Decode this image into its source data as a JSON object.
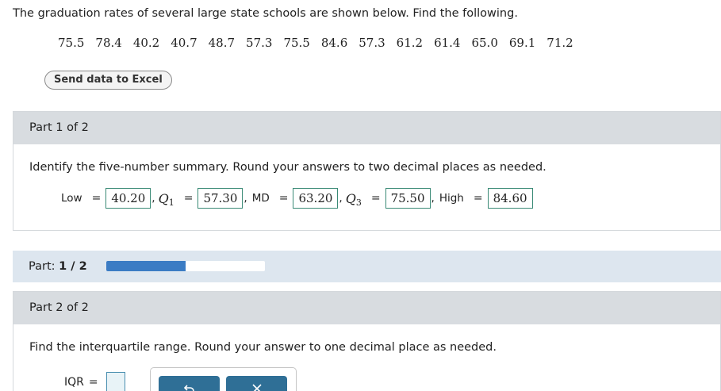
{
  "question": {
    "intro": "The graduation rates of several large state schools are shown below. Find the following.",
    "data_values": [
      "75.5",
      "78.4",
      "40.2",
      "40.7",
      "48.7",
      "57.3",
      "75.5",
      "84.6",
      "57.3",
      "61.2",
      "61.4",
      "65.0",
      "69.1",
      "71.2"
    ],
    "send_button": "Send data to Excel"
  },
  "part1": {
    "header": "Part 1 of 2",
    "prompt": "Identify the five-number summary. Round your answers to two decimal places as needed.",
    "low_label": "Low",
    "q1_symbol": "Q",
    "q1_sub": "1",
    "md_label": "MD",
    "q3_symbol": "Q",
    "q3_sub": "3",
    "high_label": "High",
    "equals": "=",
    "comma": ",",
    "low_value": "40.20",
    "q1_value": "57.30",
    "md_value": "63.20",
    "q3_value": "75.50",
    "high_value": "84.60"
  },
  "progress": {
    "label_prefix": "Part:",
    "label_value": "1 / 2",
    "fraction": 0.5,
    "fill_color": "#3b7cc4"
  },
  "part2": {
    "header": "Part 2 of 2",
    "prompt": "Find the interquartile range. Round your answer to one decimal place as needed.",
    "iqr_label": "IQR",
    "equals": "=",
    "iqr_value": "",
    "undo_icon": "undo-icon",
    "clear_icon": "close-icon"
  },
  "colors": {
    "header_bg": "#d8dce0",
    "progress_bg": "#dde6ef",
    "answer_border": "#3a8a76",
    "tool_button": "#2f6f96"
  }
}
